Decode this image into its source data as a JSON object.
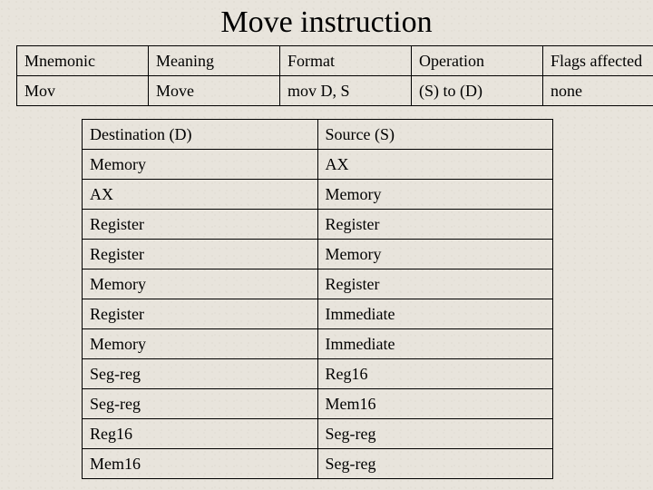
{
  "title": "Move instruction",
  "topTable": {
    "headers": [
      "Mnemonic",
      "Meaning",
      "Format",
      "Operation",
      "Flags affected"
    ],
    "row": [
      "Mov",
      "Move",
      "mov D, S",
      "(S) to (D)",
      "none"
    ]
  },
  "bottomTable": {
    "headers": [
      "Destination (D)",
      "Source (S)"
    ],
    "rows": [
      [
        "Memory",
        "AX"
      ],
      [
        "AX",
        "Memory"
      ],
      [
        "Register",
        "Register"
      ],
      [
        "Register",
        "Memory"
      ],
      [
        "Memory",
        "Register"
      ],
      [
        "Register",
        "Immediate"
      ],
      [
        "Memory",
        "Immediate"
      ],
      [
        "Seg-reg",
        "Reg16"
      ],
      [
        "Seg-reg",
        "Mem16"
      ],
      [
        "Reg16",
        "Seg-reg"
      ],
      [
        "Mem16",
        "Seg-reg"
      ]
    ]
  }
}
